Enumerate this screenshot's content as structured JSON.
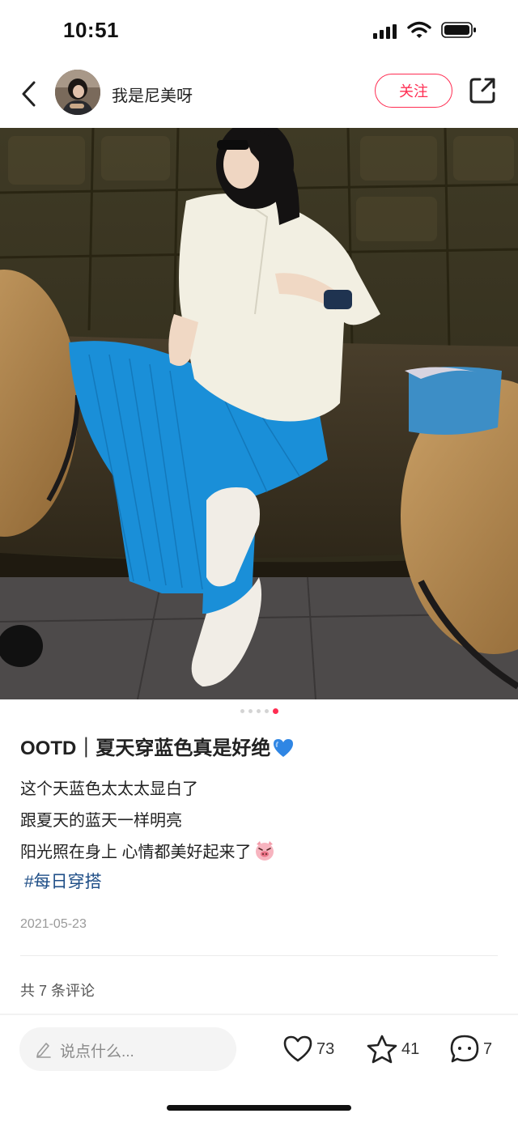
{
  "status_bar": {
    "time": "10:51"
  },
  "header": {
    "username": "我是尼美呀",
    "follow_label": "关注"
  },
  "carousel": {
    "count": 5,
    "active_index": 4
  },
  "post": {
    "title": "OOTD｜夏天穿蓝色真是好绝",
    "body_lines": [
      "这个天蓝色太太太显白了",
      "跟夏天的蓝天一样明亮",
      "阳光照在身上 心情都美好起来了"
    ],
    "hashtag": "#每日穿搭",
    "date": "2021-05-23",
    "comment_count_text": "共 7 条评论"
  },
  "bottom_bar": {
    "comment_placeholder": "说点什么...",
    "like_count": "73",
    "favorite_count": "41",
    "comment_count": "7"
  },
  "colors": {
    "accent": "#ff2d52",
    "hashtag": "#1e4e87",
    "pants_blue": "#1a8fd8"
  }
}
